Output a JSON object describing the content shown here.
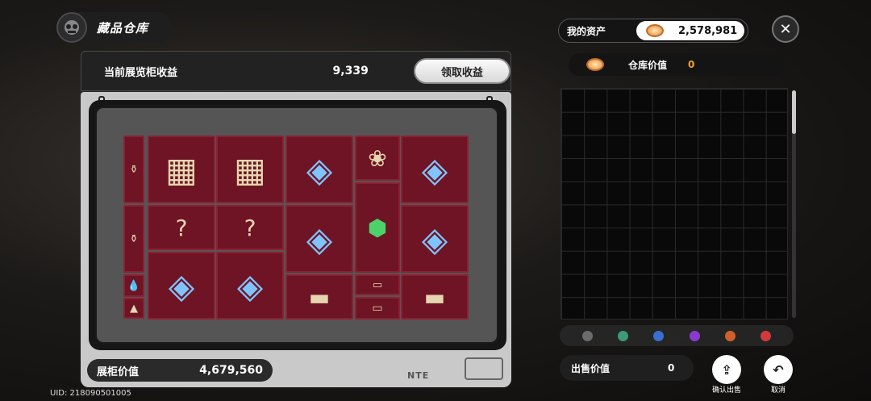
{
  "header": {
    "title": "藏品仓库"
  },
  "income": {
    "label": "当前展览柜收益",
    "value": "9,339",
    "claim_label": "领取收益"
  },
  "cabinet": {
    "value_label": "展柜价值",
    "value": "4,679,560",
    "brand": "NTE",
    "items": [
      {
        "name": "porcelain-vase-item",
        "glyph": "⚱"
      },
      {
        "name": "wooden-crate-item",
        "glyph": "▦"
      },
      {
        "name": "wooden-crate-item",
        "glyph": "▦"
      },
      {
        "name": "crystal-cube-item",
        "glyph": "◈"
      },
      {
        "name": "flower-wreath-item",
        "glyph": "❀"
      },
      {
        "name": "crystal-cube-item",
        "glyph": "◈"
      },
      {
        "name": "porcelain-vase-item",
        "glyph": "⚱"
      },
      {
        "name": "mystery-card-item",
        "glyph": "?"
      },
      {
        "name": "mystery-card-item",
        "glyph": "?"
      },
      {
        "name": "crystal-cube-item",
        "glyph": "◈"
      },
      {
        "name": "green-crystal-item",
        "glyph": "⬢"
      },
      {
        "name": "crystal-cube-item",
        "glyph": "◈"
      },
      {
        "name": "water-drop-item",
        "glyph": "💧"
      },
      {
        "name": "ember-item",
        "glyph": "▲"
      },
      {
        "name": "crystal-cube-item",
        "glyph": "◈"
      },
      {
        "name": "crystal-cube-item",
        "glyph": "◈"
      },
      {
        "name": "metal-case-item",
        "glyph": "▬"
      },
      {
        "name": "usb-drive-item",
        "glyph": "▭"
      },
      {
        "name": "usb-drive-item",
        "glyph": "▭"
      },
      {
        "name": "metal-case-item",
        "glyph": "▬"
      }
    ]
  },
  "uid": "UID: 218090501005",
  "assets": {
    "label": "我的资产",
    "value": "2,578,981"
  },
  "warehouse": {
    "label": "仓库价值",
    "value": "0"
  },
  "filter_colors": [
    "#6b6b6b",
    "#3a9a7a",
    "#3a6fd0",
    "#8a3ad0",
    "#d0602a",
    "#d03a3a"
  ],
  "sell": {
    "label": "出售价值",
    "value": "0",
    "confirm_label": "确认出售",
    "cancel_label": "取消"
  }
}
